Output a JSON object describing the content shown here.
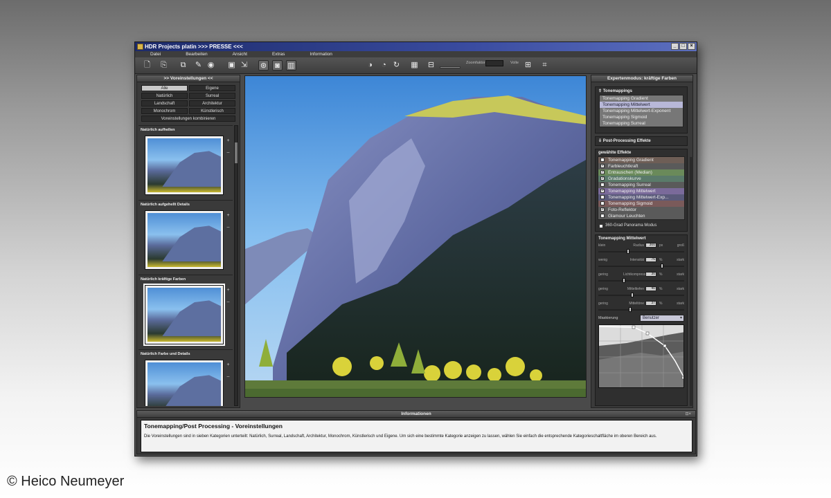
{
  "window": {
    "title": "HDR Projects platin  >>> PRESSE <<<",
    "controls": [
      "_",
      "□",
      "×"
    ]
  },
  "menu": [
    "Datei",
    "Bearbeiten",
    "Ansicht",
    "Extras",
    "Information"
  ],
  "toolbar": {
    "zoom_label": "Zoomfaktor",
    "zoom_value": "",
    "zoom_suffix": "Volle"
  },
  "left_panel": {
    "title": ">> Voreinstellungen <<",
    "categories": [
      "Alle",
      "Eigene",
      "Natürlich",
      "Surreal",
      "Landschaft",
      "Architektur",
      "Monochrom",
      "Künstlerisch"
    ],
    "combine_label": "Voreinstellungen kombinieren",
    "presets": [
      {
        "title": "Natürlich aufhellen"
      },
      {
        "title": "Natürlich aufgehellt Details"
      },
      {
        "title": "Natürlich kräftige Farben"
      },
      {
        "title": "Natürlich Farbe und Details"
      }
    ],
    "preset_add": "+",
    "preset_remove": "–"
  },
  "right_panel": {
    "title": "Expertenmodus: kräftige Farben",
    "tonemappings_title": "Tonemappings",
    "tonemappings": [
      "Tonemapping Gradient",
      "Tonemapping Mittelwert",
      "Tonemapping Mittelwert-Exponent",
      "Tonemapping Sigmoid",
      "Tonemapping Surreal"
    ],
    "postprocessing_title": "Post-Processing Effekte",
    "effects_title": "gewählte Effekte",
    "effects": [
      {
        "label": "Tonemapping Gradient",
        "checked": false,
        "color": "#6e5e56"
      },
      {
        "label": "Farbleuchtkraft",
        "checked": true,
        "color": "#5a5a5a"
      },
      {
        "label": "Entrauschen (Median)",
        "checked": true,
        "color": "#6a8a5a"
      },
      {
        "label": "Gradationskurve",
        "checked": true,
        "color": "#5a7a6a"
      },
      {
        "label": "Tonemapping Surreal",
        "checked": false,
        "color": "#5a5a5a"
      },
      {
        "label": "Tonemapping Mittelwert",
        "checked": true,
        "color": "#7a6a9a"
      },
      {
        "label": "Tonemapping Mittelwert-Exp...",
        "checked": false,
        "color": "#5a5a7a"
      },
      {
        "label": "Tonemapping Sigmoid",
        "checked": false,
        "color": "#7a5a5a"
      },
      {
        "label": "Foto-Reflektor",
        "checked": true,
        "color": "#5a5a5a"
      },
      {
        "label": "Glamour Leuchten",
        "checked": false,
        "color": "#5a5a5a"
      }
    ],
    "panorama_label": "360-Grad Panorama Modus",
    "params_title": "Tonemapping Mittelwert",
    "params": [
      {
        "low": "klein",
        "name": "Radius",
        "value": "300",
        "unit": "px",
        "high": "groß",
        "level": 0.35
      },
      {
        "low": "wenig",
        "name": "Intensität",
        "value": "76",
        "unit": "%",
        "high": "stark",
        "level": 0.76
      },
      {
        "low": "gering",
        "name": "Lichtkompression",
        "value": "30",
        "unit": "%",
        "high": "stark",
        "level": 0.3
      },
      {
        "low": "gering",
        "name": "Mitteltiefen",
        "value": "40",
        "unit": "%",
        "high": "stark",
        "level": 0.4
      },
      {
        "low": "gering",
        "name": "Mitteltöne",
        "value": "37",
        "unit": "%",
        "high": "stark",
        "level": 0.37
      }
    ],
    "masking_label": "Maskierung",
    "masking_value": "Benutzer"
  },
  "info_panel": {
    "title": "Informationen",
    "heading": "Tonemapping/Post Processing - Voreinstellungen",
    "text": "Die Voreinstellungen sind in sieben Kategorien unterteilt: Natürlich, Surreal, Landschaft, Architektur, Monochrom, Künstlerisch und Eigene. Um sich eine bestimmte Kategorie anzeigen zu lassen, wählen Sie einfach die entsprechende Kategorieschaltfläche im oberen Bereich aus."
  },
  "credit": "© Heico Neumeyer",
  "colors": {
    "title_bar": "#2a3a8a",
    "panel_bg": "#3a3a3a",
    "selected_item": "#b8b8d8"
  }
}
